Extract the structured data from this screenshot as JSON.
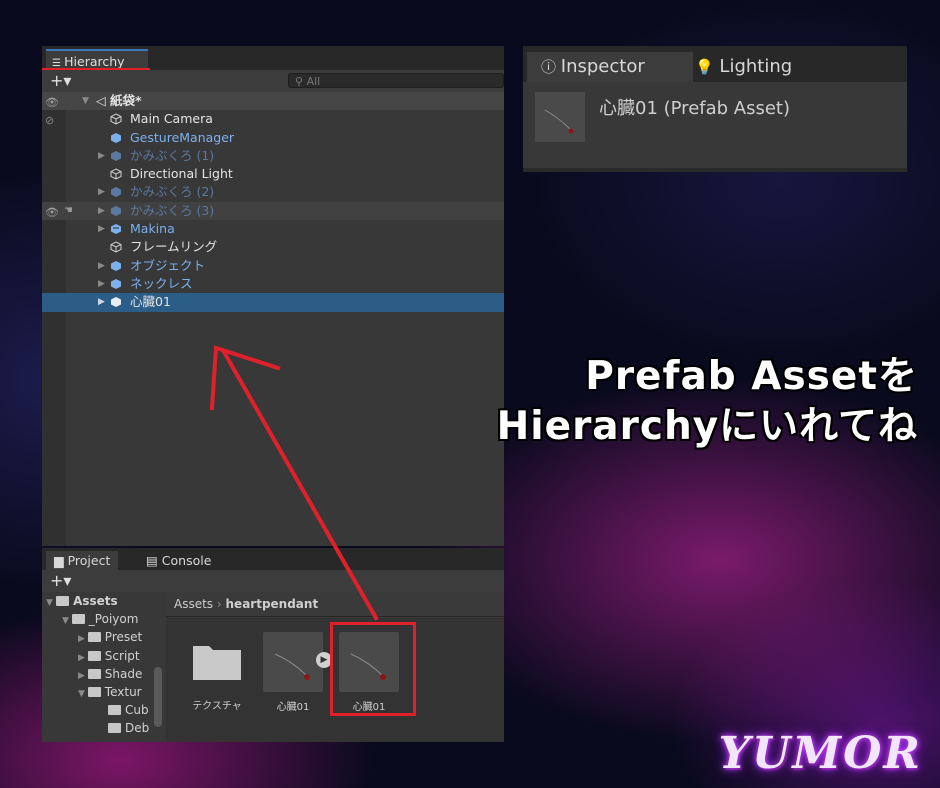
{
  "hierarchy": {
    "tab_label": "Hierarchy",
    "add_label": "+▾",
    "search_placeholder": "All",
    "scene_name": "紙袋*",
    "items": [
      {
        "label": "Main Camera"
      },
      {
        "label": "GestureManager"
      },
      {
        "label": "かみぶくろ (1)"
      },
      {
        "label": "Directional Light"
      },
      {
        "label": "かみぶくろ (2)"
      },
      {
        "label": "かみぶくろ (3)"
      },
      {
        "label": "Makina"
      },
      {
        "label": "フレームリング"
      },
      {
        "label": "オブジェクト"
      },
      {
        "label": "ネックレス"
      },
      {
        "label": "心臓01"
      }
    ]
  },
  "project": {
    "tabs": [
      "Project",
      "Console"
    ],
    "add_label": "+▾",
    "tree": [
      "Assets",
      "_Poiyom",
      "Preset",
      "Script",
      "Shade",
      "Textur",
      "Cub",
      "Deb"
    ],
    "breadcrumb": [
      "Assets",
      "heartpendant"
    ],
    "assets": [
      {
        "label": "テクスチャ"
      },
      {
        "label": "心臓01"
      },
      {
        "label": "心臓01"
      }
    ]
  },
  "inspector": {
    "tabs": [
      "Inspector",
      "Lighting"
    ],
    "title": "心臓01 (Prefab Asset)"
  },
  "overlay": {
    "line1": "Prefab Assetを",
    "line2": "Hierarchyにいれてね",
    "brand": "YUMOR"
  },
  "colors": {
    "accent_red": "#e0202a",
    "selection": "#2c5d87",
    "prefab_blue": "#7cb1ee"
  }
}
